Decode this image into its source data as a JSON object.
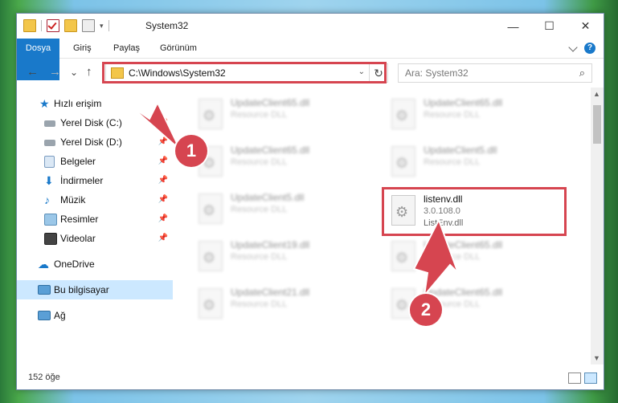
{
  "window": {
    "title": "System32",
    "controls": {
      "minimize": "—",
      "maximize": "☐",
      "close": "✕"
    }
  },
  "ribbon": {
    "tabs": [
      "Dosya",
      "Giriş",
      "Paylaş",
      "Görünüm"
    ]
  },
  "nav": {
    "back": "←",
    "forward": "→",
    "recent": "⌄",
    "up": "↑",
    "address": "C:\\Windows\\System32",
    "refresh": "↻",
    "search_placeholder": "Ara: System32"
  },
  "sidebar": {
    "items": [
      {
        "label": "Hızlı erişim",
        "icon": "star-icon",
        "pinned": false
      },
      {
        "label": "Yerel Disk (C:)",
        "icon": "drive-icon",
        "pinned": true
      },
      {
        "label": "Yerel Disk (D:)",
        "icon": "drive-icon",
        "pinned": true
      },
      {
        "label": "Belgeler",
        "icon": "documents-icon",
        "pinned": true
      },
      {
        "label": "İndirmeler",
        "icon": "download-icon",
        "pinned": true
      },
      {
        "label": "Müzik",
        "icon": "music-icon",
        "pinned": true
      },
      {
        "label": "Resimler",
        "icon": "pictures-icon",
        "pinned": true
      },
      {
        "label": "Videolar",
        "icon": "videos-icon",
        "pinned": true
      },
      {
        "label": "OneDrive",
        "icon": "cloud-icon",
        "pinned": false
      },
      {
        "label": "Bu bilgisayar",
        "icon": "computer-icon",
        "pinned": false,
        "selected": true
      },
      {
        "label": "Ağ",
        "icon": "network-icon",
        "pinned": false
      }
    ]
  },
  "files": [
    {
      "name": "UpdateClient65.dll",
      "type": "Resource DLL"
    },
    {
      "name": "UpdateClient65.dll",
      "type": "Resource DLL"
    },
    {
      "name": "UpdateClient65.dll",
      "type": "Resource DLL"
    },
    {
      "name": "UpdateClient5.dll",
      "type": "Resource DLL"
    },
    {
      "name": "UpdateClient5.dll",
      "type": "Resource DLL"
    },
    {
      "name": "UpdateClient19.dll",
      "type": "Resource DLL"
    },
    {
      "name": "UpdateClient65.dll",
      "type": "Resource DLL"
    },
    {
      "name": "UpdateClient21.dll",
      "type": "Resource DLL"
    },
    {
      "name": "UpdateClient65.dll",
      "type": "Resource DLL"
    }
  ],
  "highlighted_file": {
    "name": "listenv.dll",
    "version": "3.0.108.0",
    "description": "ListEnv.dll"
  },
  "status": {
    "count": "152 öğe"
  },
  "callouts": [
    "1",
    "2"
  ],
  "colors": {
    "accent": "#1979ca",
    "highlight": "#d64550",
    "selected": "#cce8ff"
  }
}
